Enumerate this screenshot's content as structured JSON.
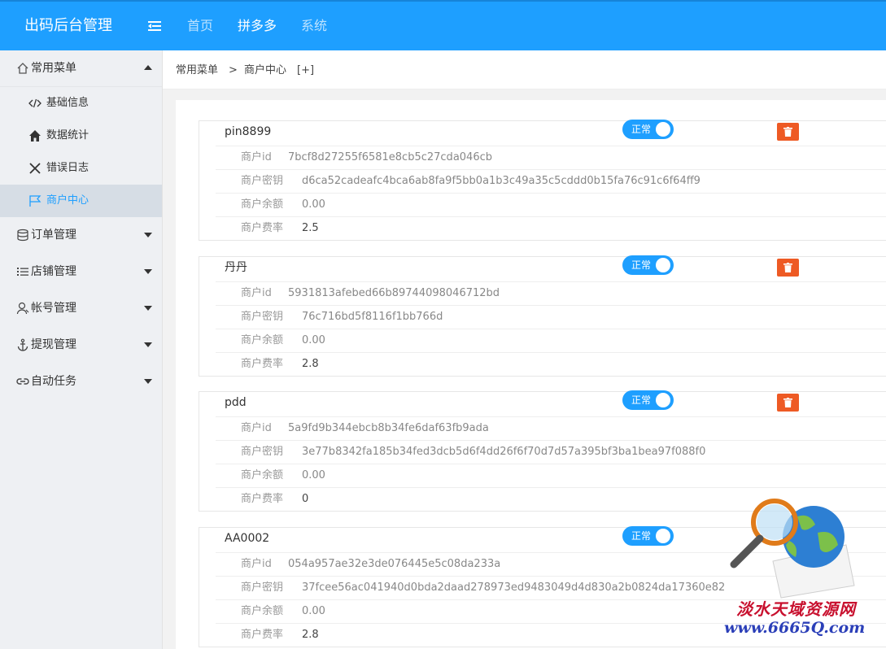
{
  "header": {
    "title": "出码后台管理",
    "nav": [
      "首页",
      "拼多多",
      "系统"
    ]
  },
  "sidebar": {
    "groups": [
      {
        "label": "常用菜单",
        "icon": "home-icon",
        "expanded": true
      },
      {
        "label": "订单管理",
        "icon": "database-icon"
      },
      {
        "label": "店铺管理",
        "icon": "list-icon"
      },
      {
        "label": "帐号管理",
        "icon": "user-icon"
      },
      {
        "label": "提现管理",
        "icon": "anchor-icon"
      },
      {
        "label": "自动任务",
        "icon": "link-icon"
      }
    ],
    "subitems": [
      {
        "label": "基础信息",
        "icon": "code-icon"
      },
      {
        "label": "数据统计",
        "icon": "home-icon"
      },
      {
        "label": "错误日志",
        "icon": "close-icon"
      },
      {
        "label": "商户中心",
        "icon": "flag-icon",
        "active": true
      }
    ]
  },
  "breadcrumb": {
    "root": "常用菜单",
    "sep": ">",
    "current": "商户中心",
    "expand": "[+]"
  },
  "fields": {
    "id": "商户id",
    "key": "商户密钥",
    "balance": "商户余额",
    "rate": "商户费率"
  },
  "status_label": "正常",
  "merchants": [
    {
      "name": "pin8899",
      "id": "7bcf8d27255f6581e8cb5c27cda046cb",
      "key": "d6ca52cadeafc4bca6ab8fa9f5bb0a1b3c49a35c5cddd0b15fa76c91c6f64ff9",
      "balance": "0.00",
      "rate": "2.5"
    },
    {
      "name": "丹丹",
      "id": "5931813afebed66b89744098046712bd",
      "key": "76c716bd5f8116f1bb766d",
      "balance": "0.00",
      "rate": "2.8"
    },
    {
      "name": "pdd",
      "id": "5a9fd9b344ebcb8b34fe6daf63fb9ada",
      "key": "3e77b8342fa185b34fed3dcb5d6f4dd26f6f70d7d57a395bf3ba1bea97f088f0",
      "balance": "0.00",
      "rate": "0"
    },
    {
      "name": "AA0002",
      "id": "054a957ae32e3de076445e5c08da233a",
      "key": "37fcee56ac041940d0bda2daad278973ed9483049d4d830a2b0824da17360e82",
      "balance": "0.00",
      "rate": "2.8"
    }
  ],
  "watermark": {
    "line1": "淡水天域资源网",
    "line2": "www.6665Q.com"
  },
  "colors": {
    "primary": "#1e9fff",
    "danger": "#ee5a24"
  }
}
